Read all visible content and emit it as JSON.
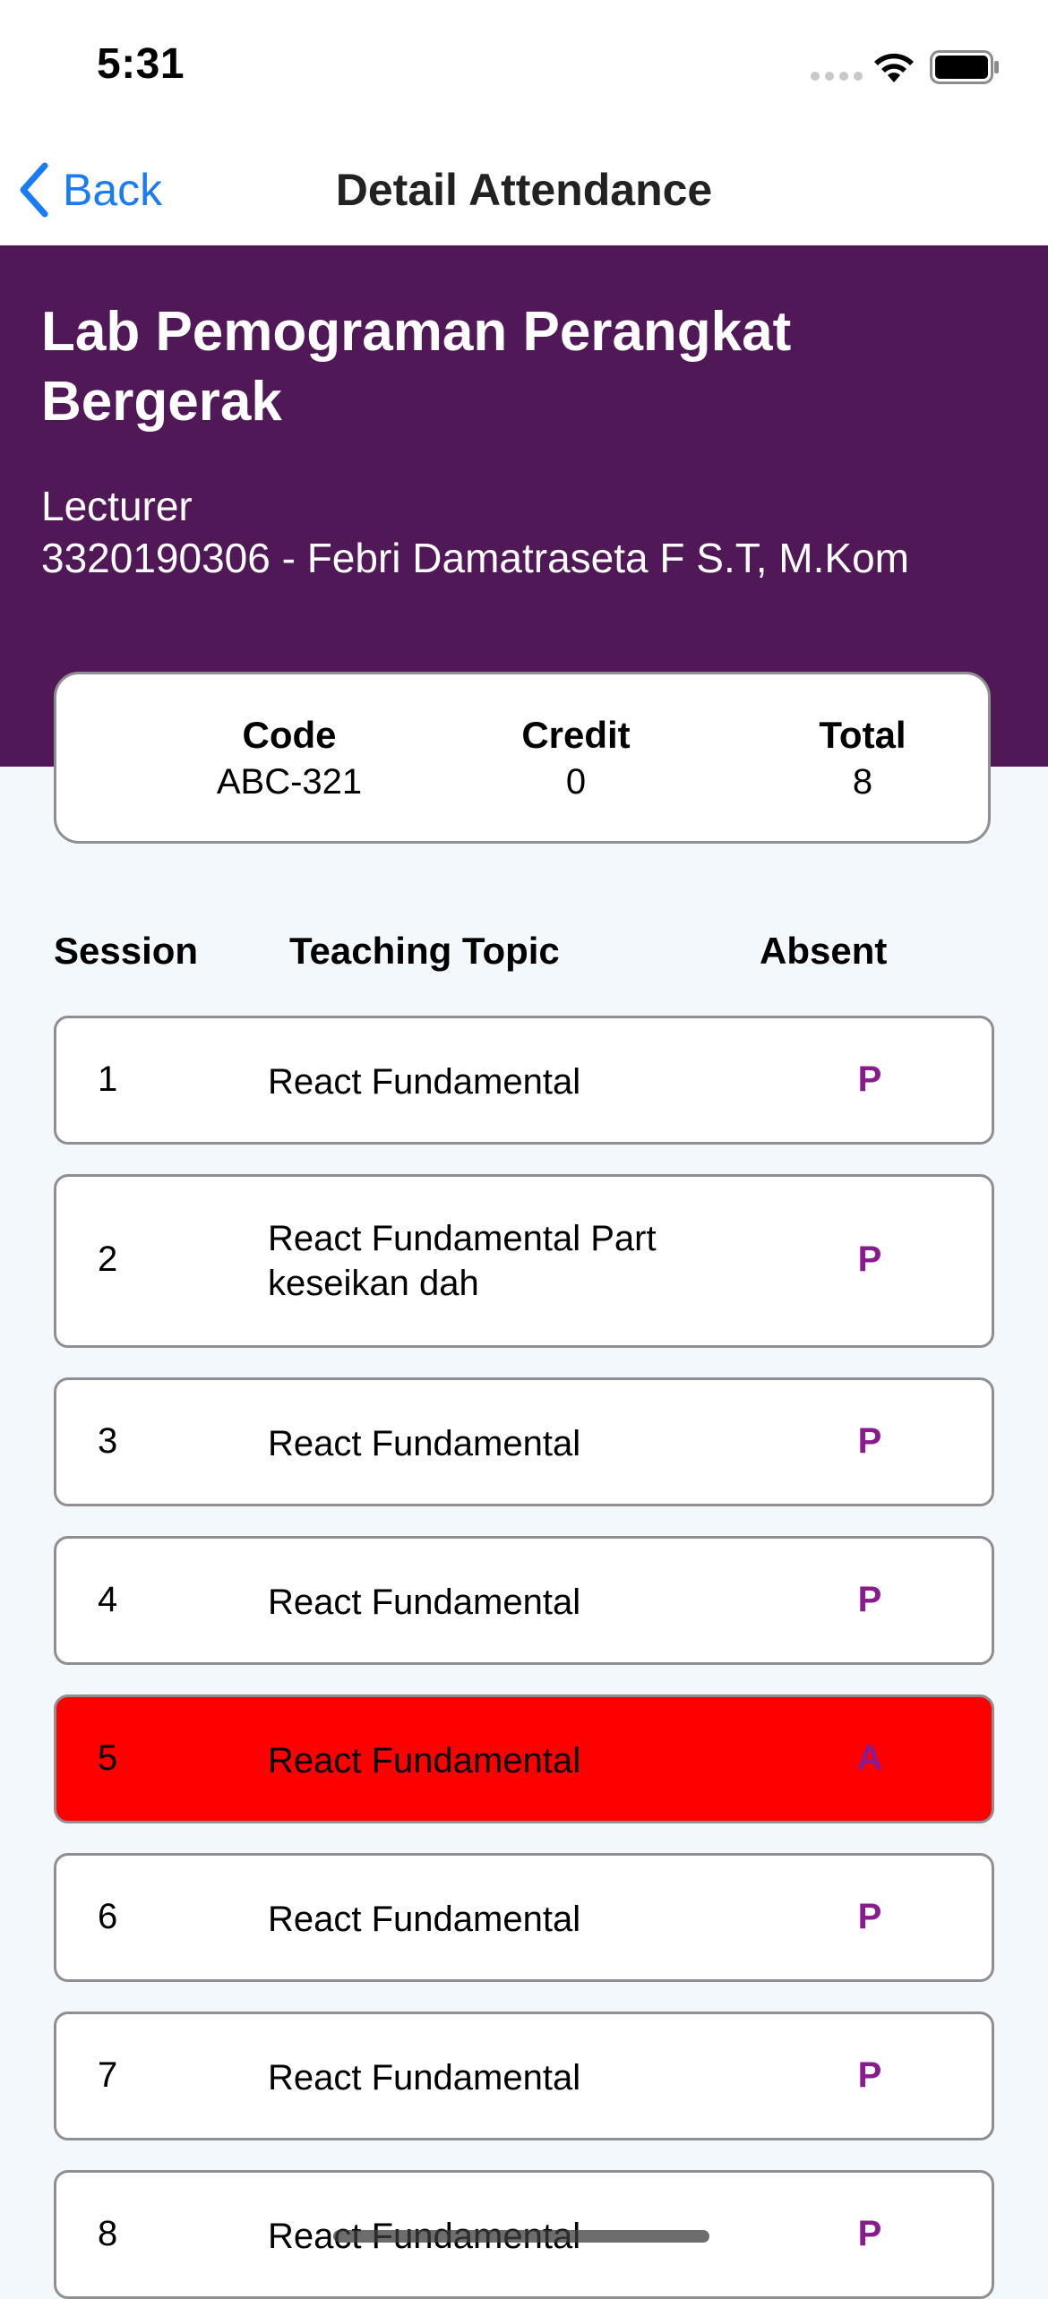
{
  "status_bar": {
    "time": "5:31"
  },
  "nav": {
    "back_label": "Back",
    "title": "Detail Attendance"
  },
  "course": {
    "title": "Lab Pemograman Perangkat Bergerak",
    "lecturer_label": "Lecturer",
    "lecturer": "3320190306 - Febri Damatraseta F S.T, M.Kom"
  },
  "info": {
    "code_label": "Code",
    "code_value": "ABC-321",
    "credit_label": "Credit",
    "credit_value": "0",
    "total_label": "Total",
    "total_value": "8"
  },
  "table": {
    "headers": {
      "session": "Session",
      "topic": "Teaching Topic",
      "absent": "Absent"
    },
    "rows": [
      {
        "session": "1",
        "topic": "React Fundamental",
        "status": "P"
      },
      {
        "session": "2",
        "topic": "React Fundamental Part keseikan dah",
        "status": "P"
      },
      {
        "session": "3",
        "topic": "React Fundamental",
        "status": "P"
      },
      {
        "session": "4",
        "topic": "React Fundamental",
        "status": "P"
      },
      {
        "session": "5",
        "topic": "React Fundamental",
        "status": "A"
      },
      {
        "session": "6",
        "topic": "React Fundamental",
        "status": "P"
      },
      {
        "session": "7",
        "topic": "React Fundamental",
        "status": "P"
      },
      {
        "session": "8",
        "topic": "React Fundamental",
        "status": "P"
      }
    ]
  },
  "colors": {
    "header_band": "#501857",
    "present_mark": "#8a1b8f",
    "absent_row": "#ff0000",
    "link_blue": "#1a7cf5"
  }
}
